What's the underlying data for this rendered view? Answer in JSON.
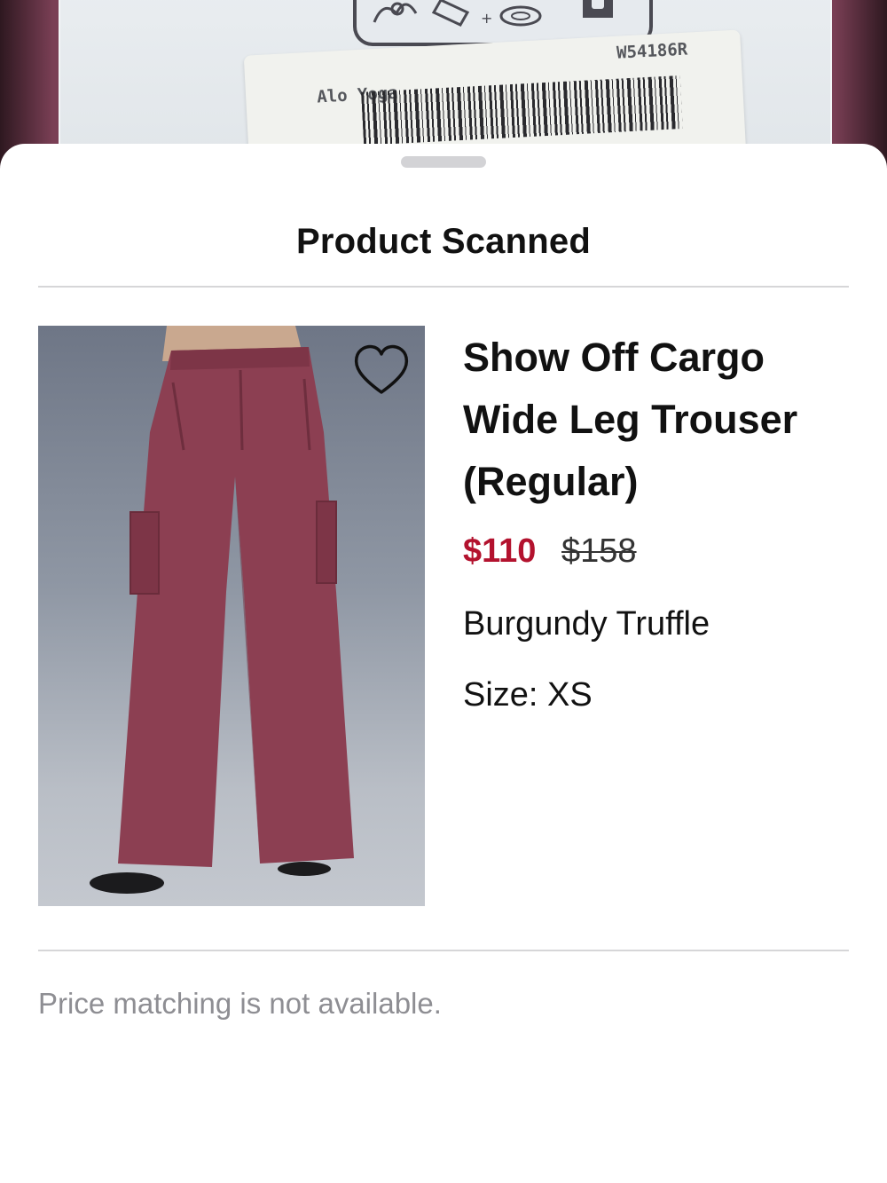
{
  "camera": {
    "tag_brand": "Alo Yoga",
    "tag_code": "W54186R",
    "tag_count": "1"
  },
  "sheet": {
    "title": "Product Scanned"
  },
  "product": {
    "name": "Show Off Cargo Wide Leg Trouser (Regular)",
    "price_sale": "$110",
    "price_original": "$158",
    "color": "Burgundy Truffle",
    "size_label": "Size:",
    "size_value": "XS",
    "favorite_icon": "heart-outline-icon",
    "sale_color": "#b3122e"
  },
  "footer": {
    "note": "Price matching is not available."
  }
}
